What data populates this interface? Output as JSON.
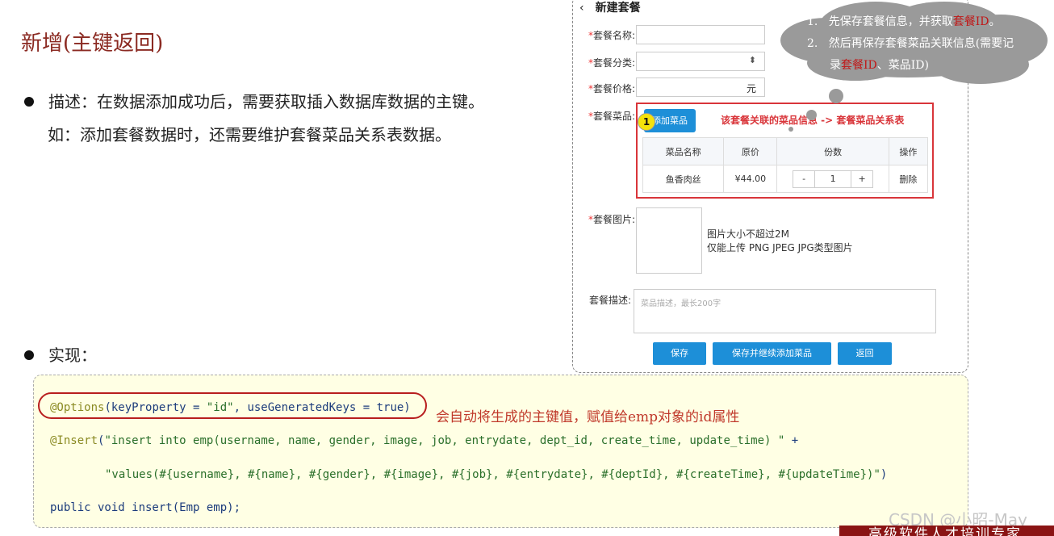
{
  "slide": {
    "title": "新增(主键返回)",
    "bullet1_line1": "描述：在数据添加成功后，需要获取插入数据库数据的主键。",
    "bullet1_line2": "如：添加套餐数据时，还需要维护套餐菜品关系表数据。",
    "bullet2": "实现："
  },
  "form": {
    "back_icon": "chevron-left",
    "title": "新建套餐",
    "required_mark": "*",
    "name_label": "套餐名称:",
    "category_label": "套餐分类:",
    "price_label": "套餐价格:",
    "price_suffix": "元",
    "dishes_label": "套餐菜品:",
    "add_dish_button": "添加菜品",
    "step_badge": "1",
    "dish_note": "该套餐关联的菜品信息 -> 套餐菜品关系表",
    "table_headers": [
      "菜品名称",
      "原价",
      "份数",
      "操作"
    ],
    "dish_rows": [
      {
        "name": "鱼香肉丝",
        "price": "¥44.00",
        "minus": "-",
        "qty": "1",
        "plus": "+",
        "action": "删除"
      }
    ],
    "image_label": "套餐图片:",
    "image_hint_1": "图片大小不超过2M",
    "image_hint_2": "仅能上传 PNG JPEG JPG类型图片",
    "desc_label": "套餐描述:",
    "desc_placeholder": "菜品描述，最长200字",
    "save_button": "保存",
    "save_continue_button": "保存并继续添加菜品",
    "return_button": "返回"
  },
  "cloud": {
    "n1": "1.",
    "line1_a": "先保存套餐信息，并获取",
    "line1_hl": "套餐ID",
    "line1_b": "。",
    "n2": "2.",
    "line2_a": "然后再保存套餐菜品关联信息(需要记",
    "line3_a": "录",
    "line3_hl": "套餐ID",
    "line3_b": "、菜品ID)"
  },
  "code": {
    "line1_ann": "@Options",
    "line1_rest": "(keyProperty = ",
    "line1_str": "\"id\"",
    "line1_rest2": ", useGeneratedKeys = true)",
    "line2_ann": "@Insert",
    "line2_rest": "(",
    "line2_str": "\"insert into emp(username, name, gender, image, job, entrydate, dept_id, create_time, update_time) \"",
    "line2_rest2": " +",
    "line3_str": "\"values(#{username}, #{name}, #{gender}, #{image}, #{job}, #{entrydate}, #{deptId}, #{createTime}, #{updateTime})\"",
    "line3_rest": ")",
    "line4": "public void insert(Emp emp);",
    "note": "会自动将生成的主键值，赋值给emp对象的id属性"
  },
  "watermark": "CSDN @小昭-May",
  "footer": "高级软件人才培训专家"
}
